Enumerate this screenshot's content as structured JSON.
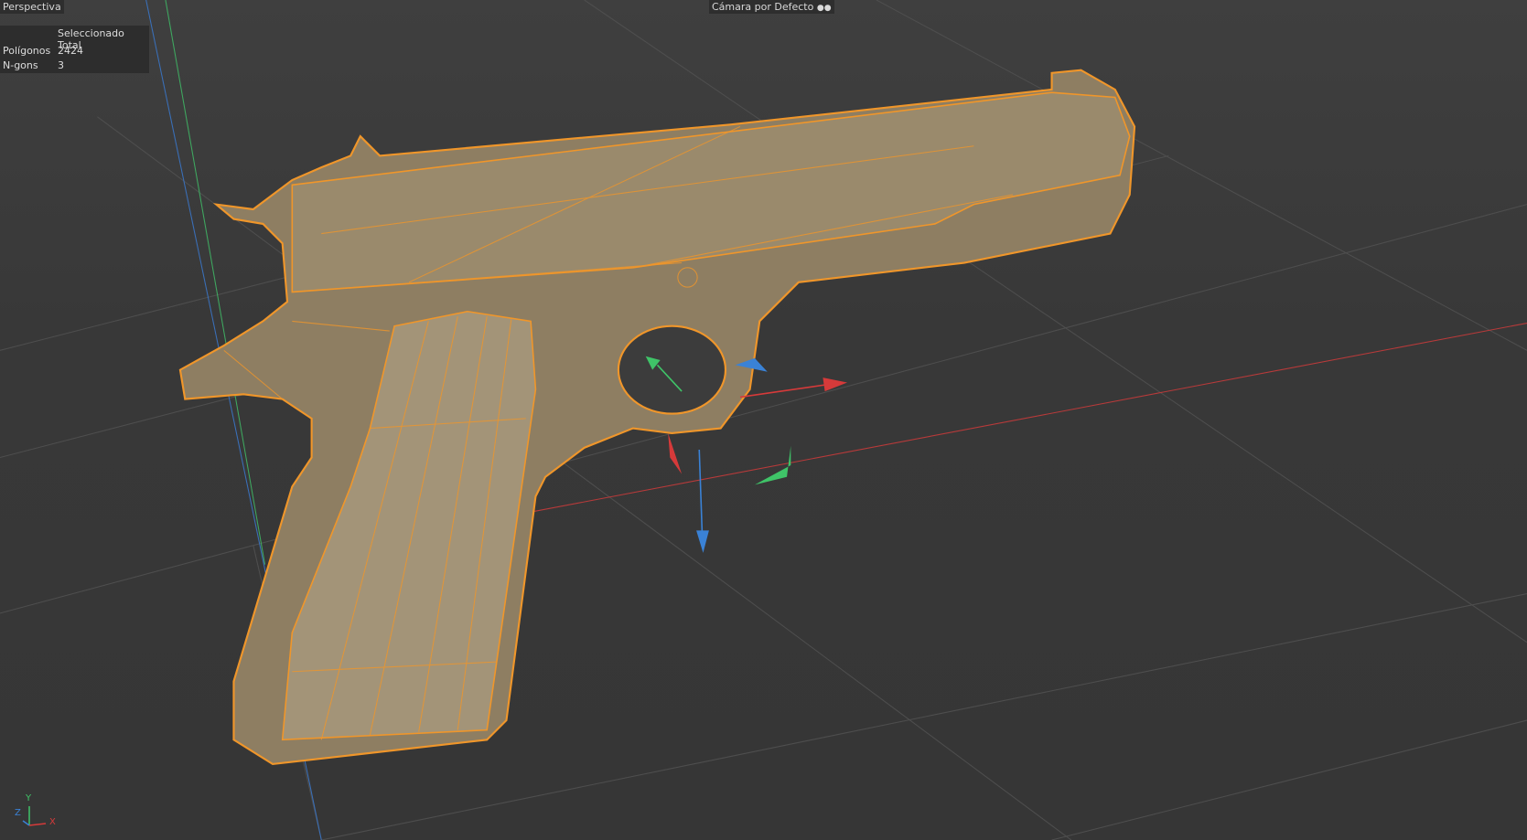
{
  "viewport": {
    "view_name": "Perspectiva",
    "camera_name": "Cámara por Defecto"
  },
  "hud": {
    "header": "Seleccionado Total",
    "rows": [
      {
        "label": "Polígonos",
        "value": "2424"
      },
      {
        "label": "N-gons",
        "value": "3"
      }
    ]
  },
  "axis_indicator": {
    "x": "X",
    "y": "Y",
    "z": "Z"
  },
  "colors": {
    "selection": "#f0962a",
    "mesh": "#8e7e62",
    "x_axis": "#d63a3a",
    "y_axis": "#3fc468",
    "z_axis": "#3a82d6"
  }
}
